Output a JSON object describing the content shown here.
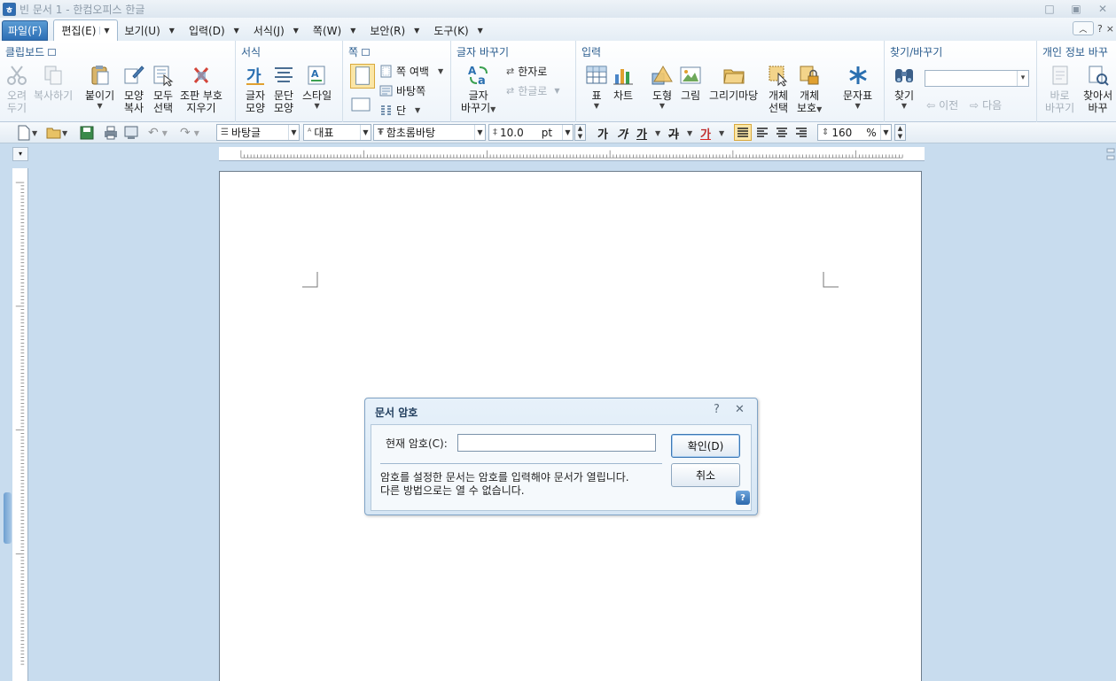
{
  "window": {
    "title": "빈 문서 1 - 한컴오피스 한글",
    "minimize": "□",
    "restore": "▣",
    "close": "✕"
  },
  "menu": {
    "file": "파일(F)",
    "tabs": [
      {
        "label": "편집(E)"
      },
      {
        "label": "보기(U)"
      },
      {
        "label": "입력(D)"
      },
      {
        "label": "서식(J)"
      },
      {
        "label": "쪽(W)"
      },
      {
        "label": "보안(R)"
      },
      {
        "label": "도구(K)"
      }
    ],
    "help": "?",
    "close": "×"
  },
  "ribbon": {
    "clipboard": {
      "title": "클립보드",
      "cut": [
        "오려",
        "두기"
      ],
      "copy": "복사하기",
      "paste": "붙이기",
      "format_copy": [
        "모양",
        "복사"
      ],
      "select_all": [
        "모두",
        "선택"
      ],
      "clear_marks": [
        "조판 부호",
        "지우기"
      ]
    },
    "format": {
      "title": "서식",
      "char_shape": [
        "글자",
        "모양"
      ],
      "para_shape": [
        "문단",
        "모양"
      ],
      "style": "스타일"
    },
    "page": {
      "title": "쪽",
      "margin": "쪽 여백",
      "master": "바탕쪽",
      "columns": "단"
    },
    "replace": {
      "title": "글자 바꾸기",
      "change": [
        "글자",
        "바꾸기"
      ],
      "to_hanja": "한자로",
      "to_hangul": "한글로"
    },
    "insert": {
      "title": "입력",
      "table": "표",
      "chart": "차트",
      "shape": "도형",
      "picture": "그림",
      "drawing": "그리기마당",
      "obj_select": [
        "개체",
        "선택"
      ],
      "obj_protect": [
        "개체",
        "보호"
      ],
      "symbols": "문자표"
    },
    "find": {
      "title": "찾기/바꾸기",
      "find": "찾기",
      "prev": "이전",
      "next": "다음"
    },
    "privacy": {
      "title": "개인 정보 바꾸",
      "quick": [
        "바로",
        "바꾸기"
      ],
      "find_replace": [
        "찾아서",
        "바꾸"
      ]
    }
  },
  "toolbar": {
    "style": "바탕글",
    "lang": "대표",
    "font": "함초롬바탕",
    "size": "10.0",
    "unit": "pt",
    "bold": "가",
    "italic": "가",
    "underline": "가",
    "strike": "가",
    "color": "가",
    "zoom": "160",
    "zoom_unit": "%"
  },
  "dialog": {
    "title": "문서 암호",
    "help": "?",
    "close": "✕",
    "current_password_label": "현재 암호(C):",
    "password_value": "",
    "info_line1": "암호를 설정한 문서는 암호를 입력해야 문서가 열립니다.",
    "info_line2": "다른 방법으로는 열 수 없습니다.",
    "ok": "확인(D)",
    "cancel": "취소"
  },
  "colors": {
    "accent": "#2d6fb5",
    "ribbon_title": "#2b5d8f",
    "workspace": "#c8dcee"
  }
}
